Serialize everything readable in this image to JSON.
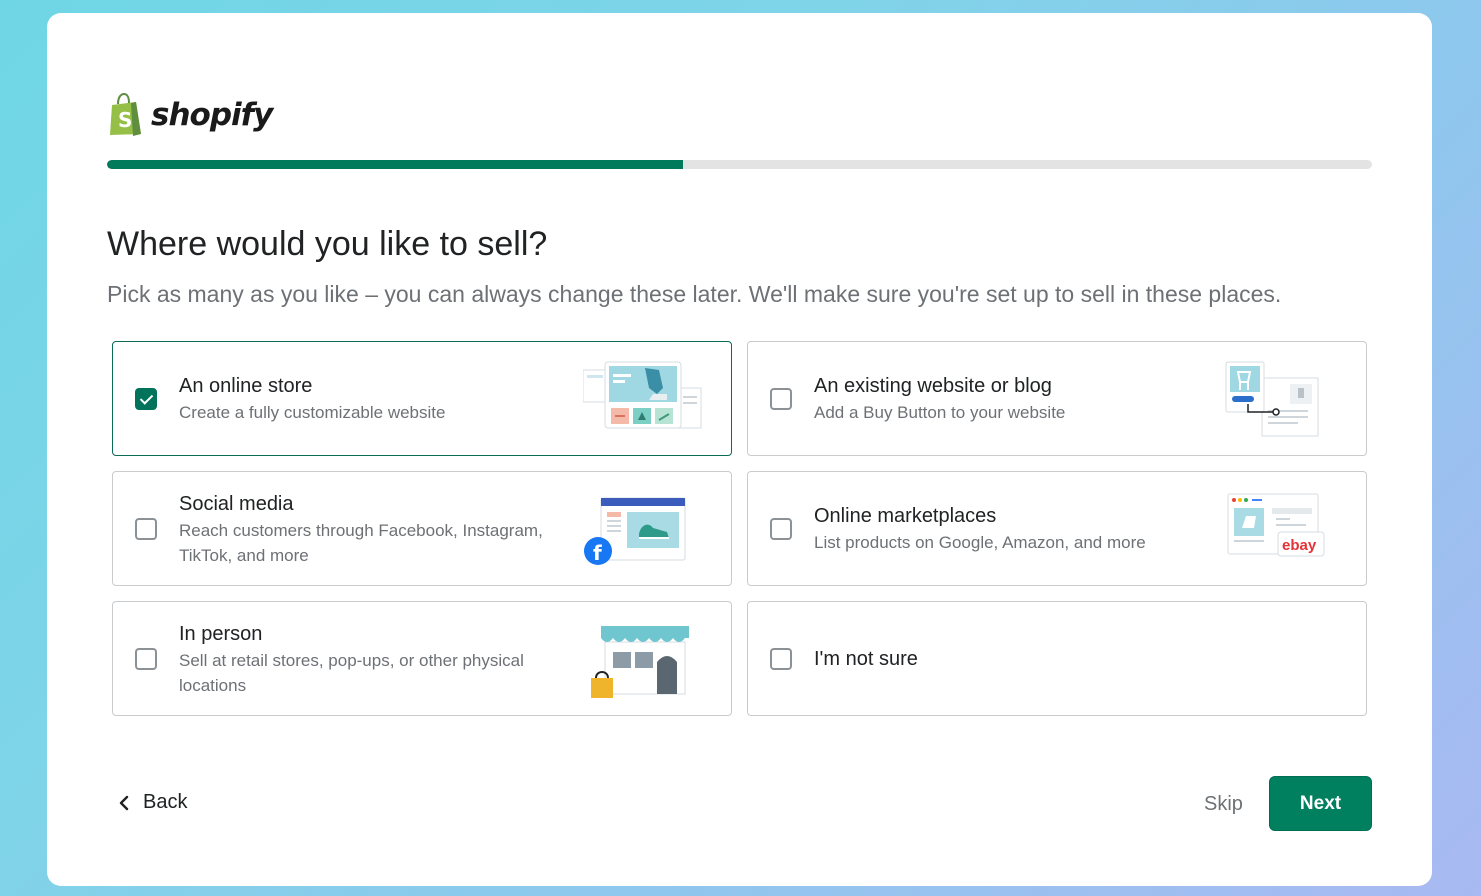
{
  "brand": {
    "name": "shopify",
    "accent": "#008060"
  },
  "progress": {
    "fraction": 0.455
  },
  "heading": {
    "title": "Where would you like to sell?",
    "subtitle": "Pick as many as you like – you can always change these later. We'll make sure you're set up to sell in these places."
  },
  "options": [
    {
      "title": "An online store",
      "desc": "Create a fully customizable website",
      "checked": true,
      "icon": "online-store-illustration"
    },
    {
      "title": "An existing website or blog",
      "desc": "Add a Buy Button to your website",
      "checked": false,
      "icon": "buy-button-illustration"
    },
    {
      "title": "Social media",
      "desc": "Reach customers through Facebook, Instagram, TikTok, and more",
      "checked": false,
      "icon": "social-media-illustration"
    },
    {
      "title": "Online marketplaces",
      "desc": "List products on Google, Amazon, and more",
      "checked": false,
      "icon": "marketplace-illustration"
    },
    {
      "title": "In person",
      "desc": "Sell at retail stores, pop-ups, or other physical locations",
      "checked": false,
      "icon": "storefront-illustration"
    },
    {
      "title": "I'm not sure",
      "desc": "",
      "checked": false,
      "icon": ""
    }
  ],
  "footer": {
    "back": "Back",
    "skip": "Skip",
    "next": "Next"
  },
  "illustrations": {
    "ebay_text": "ebay"
  }
}
